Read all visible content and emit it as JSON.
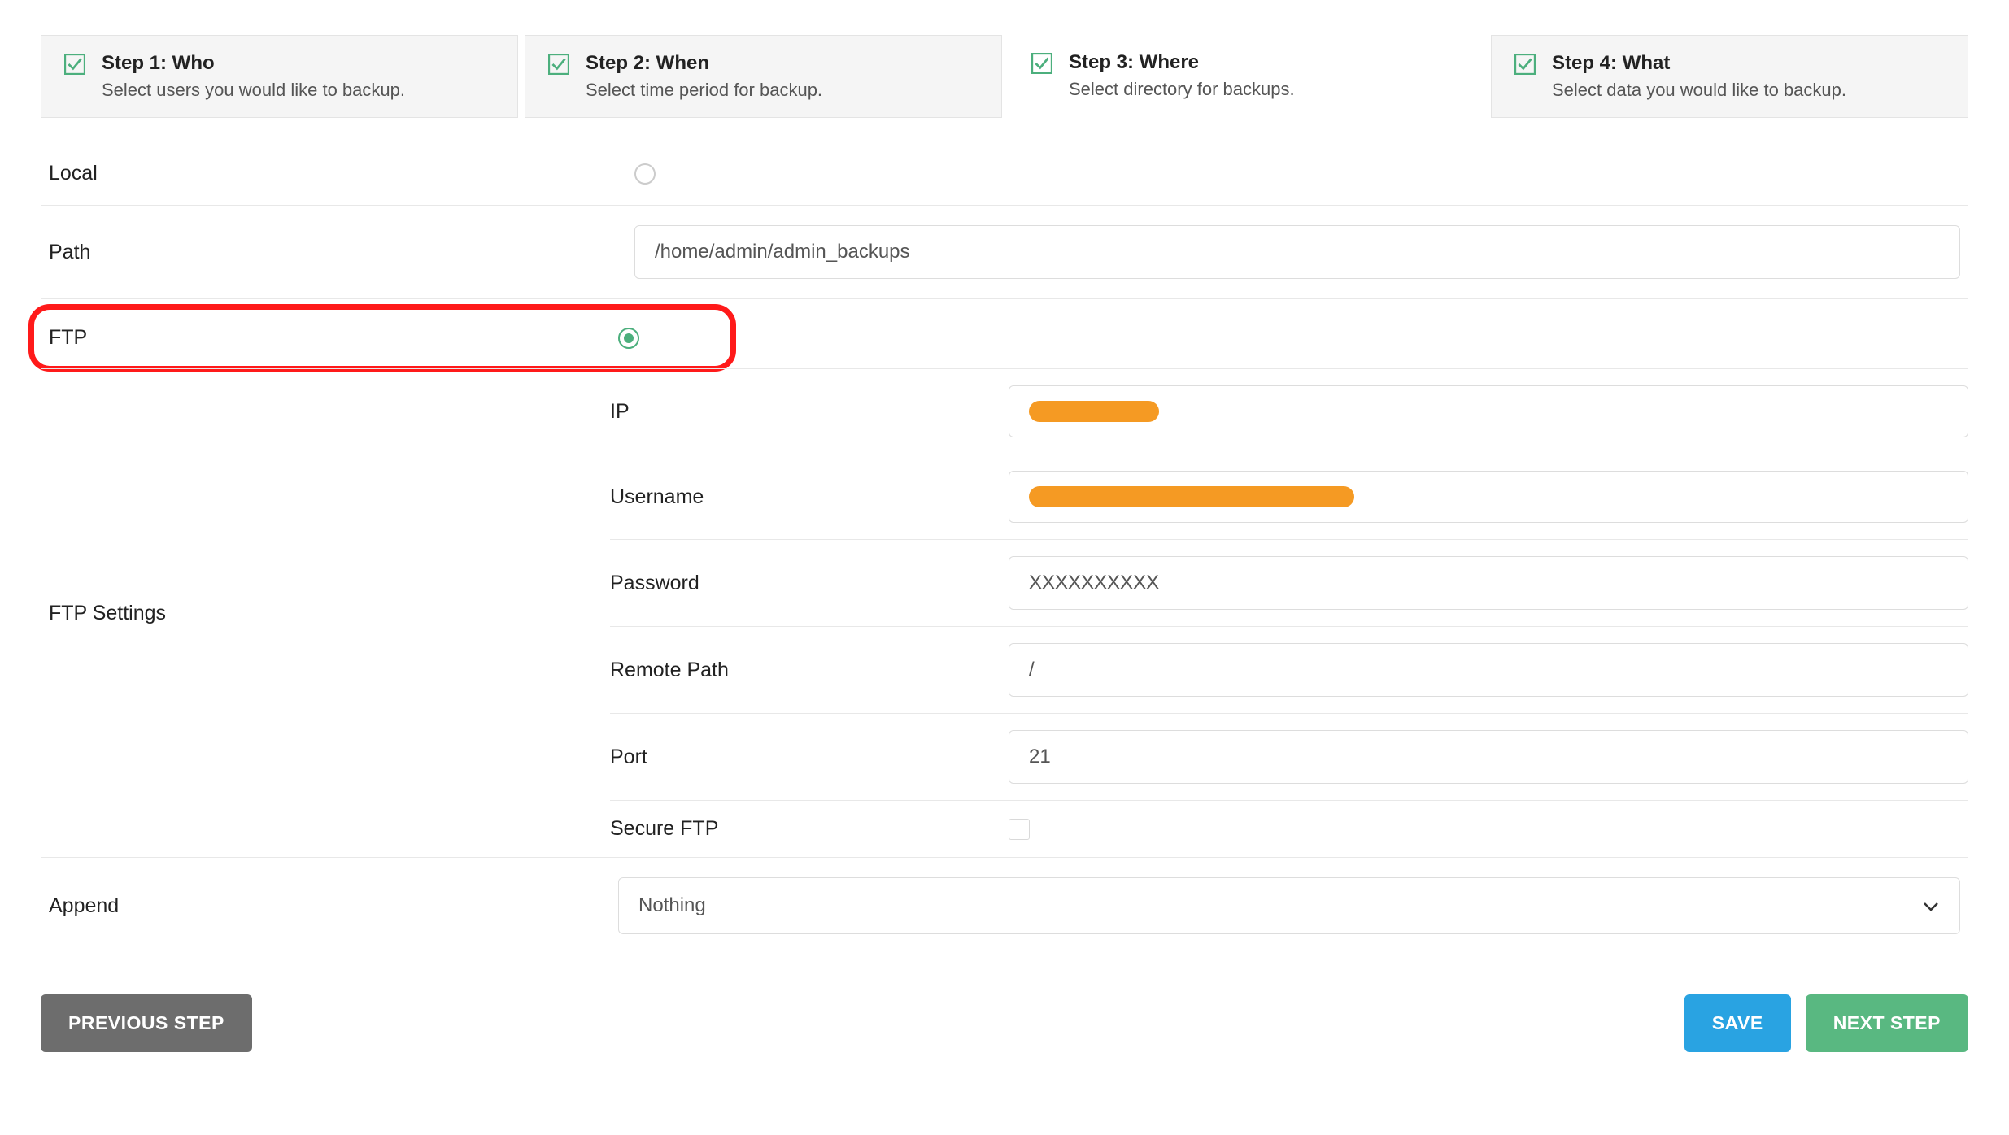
{
  "steps": [
    {
      "title": "Step 1: Who",
      "desc": "Select users you would like to backup."
    },
    {
      "title": "Step 2: When",
      "desc": "Select time period for backup."
    },
    {
      "title": "Step 3: Where",
      "desc": "Select directory for backups."
    },
    {
      "title": "Step 4: What",
      "desc": "Select data you would like to backup."
    }
  ],
  "labels": {
    "local": "Local",
    "path": "Path",
    "ftp": "FTP",
    "ftp_settings": "FTP Settings",
    "ip": "IP",
    "username": "Username",
    "password": "Password",
    "remote_path": "Remote Path",
    "port": "Port",
    "secure_ftp": "Secure FTP",
    "append": "Append"
  },
  "values": {
    "path": "/home/admin/admin_backups",
    "password": "XXXXXXXXXX",
    "remote_path": "/",
    "port": "21",
    "append_selected": "Nothing"
  },
  "buttons": {
    "previous": "PREVIOUS STEP",
    "save": "SAVE",
    "next": "NEXT STEP"
  },
  "colors": {
    "highlight": "#ff1a1a",
    "check_green": "#4caf7d",
    "redact_orange": "#f59a23",
    "btn_blue": "#29a3e2",
    "btn_green": "#59b881"
  }
}
